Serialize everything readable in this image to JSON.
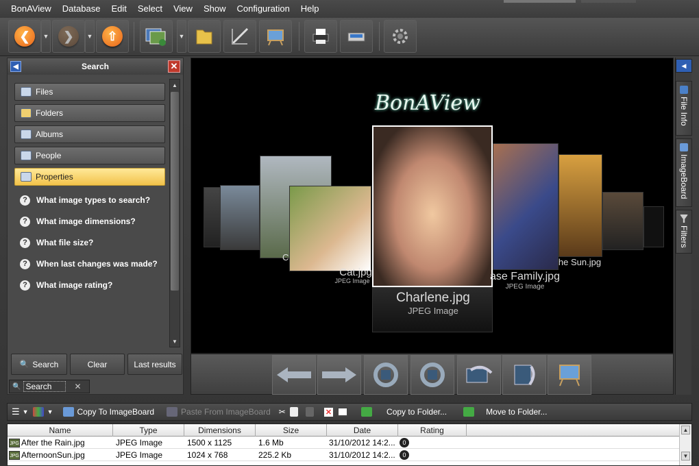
{
  "app": {
    "name": "BonAView"
  },
  "menu": [
    "BonAView",
    "Database",
    "Edit",
    "Select",
    "View",
    "Show",
    "Configuration",
    "Help"
  ],
  "toolbar": {
    "buttons": [
      "back-arrow-icon",
      "forward-arrow-icon",
      "up-arrow-icon",
      "import-photos-icon",
      "folder-icon",
      "edit-tools-icon",
      "picture-easel-icon",
      "printer-icon",
      "scanner-icon",
      "settings-gear-icon"
    ]
  },
  "search_panel": {
    "title": "Search",
    "categories": [
      "Files",
      "Folders",
      "Albums",
      "People",
      "Properties"
    ],
    "active_category": "Properties",
    "questions": [
      "What image types to search?",
      "What image dimensions?",
      "What file size?",
      "When last changes was made?",
      "What image rating?"
    ],
    "buttons": {
      "search": "Search",
      "clear": "Clear",
      "last_results": "Last results"
    },
    "tab_label": "Search"
  },
  "viewer": {
    "logo": "BonAView",
    "selected_file": "Charlene.jpg",
    "selected_type": "JPEG Image",
    "left_file": "Cat.jpg",
    "left_type": "JPEG Image",
    "left_far_label": "C",
    "right_file": "ase Family.jpg",
    "right_type": "JPEG Image",
    "right_far_label": "he Sun.jpg"
  },
  "right_tabs": [
    "File Info",
    "ImageBoard",
    "Filters"
  ],
  "bottom_toolbar": {
    "copy_to_imageboard": "Copy To ImageBoard",
    "paste_from_imageboard": "Paste From ImageBoard",
    "copy_to_folder": "Copy to Folder...",
    "move_to_folder": "Move to Folder..."
  },
  "file_list": {
    "columns": [
      "Name",
      "Type",
      "Dimensions",
      "Size",
      "Date",
      "Rating"
    ],
    "rows": [
      {
        "name": "After the Rain.jpg",
        "type": "JPEG Image",
        "dimensions": "1500 x 1125",
        "size": "1.6 Mb",
        "date": "31/10/2012 14:2...",
        "rating": "0"
      },
      {
        "name": "AfternoonSun.jpg",
        "type": "JPEG Image",
        "dimensions": "1024 x 768",
        "size": "225.2 Kb",
        "date": "31/10/2012 14:2...",
        "rating": "0"
      }
    ],
    "icon_label": "JPG"
  }
}
